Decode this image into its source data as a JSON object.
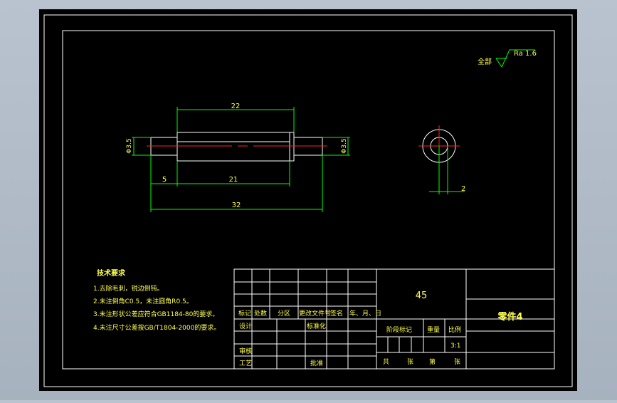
{
  "colors": {
    "background": "#000000",
    "frame": "#ffffff",
    "dimension": "#00ff00",
    "centerline": "#ff2020",
    "text": "#00ff00",
    "app_bg": "#b0bac6"
  },
  "roughness": {
    "prefix": "全部",
    "value": "Ra 1.6"
  },
  "dimensions": {
    "top_length": "22",
    "left_dia": "Φ3.5",
    "right_dia": "Φ3.5",
    "left_step": "5",
    "middle_length": "21",
    "total_length": "32",
    "side_dim": "2"
  },
  "tech_requirements": {
    "title": "技术要求",
    "lines": [
      "1.去除毛刺，锐边倒钝。",
      "2.未注倒角C0.5，未注圆角R0.5。",
      "3.未注形状公差应符合GB1184-80的要求。",
      "4.未注尺寸公差按GB/T1804-2000的要求。"
    ]
  },
  "title_block": {
    "material": "45",
    "part_name": "零件4",
    "ratio": "3:1",
    "headers": [
      "标记",
      "处数",
      "分区",
      "更改文件号",
      "签名",
      "年、月、日"
    ],
    "design": "设计",
    "standardize": "标准化",
    "stage_mark": "阶段标记",
    "weight": "重量",
    "scale": "比例",
    "review": "审核",
    "process": "工艺",
    "approve": "批准",
    "total": "共",
    "sheet": "张",
    "no": "第",
    "sheet2": "张"
  }
}
